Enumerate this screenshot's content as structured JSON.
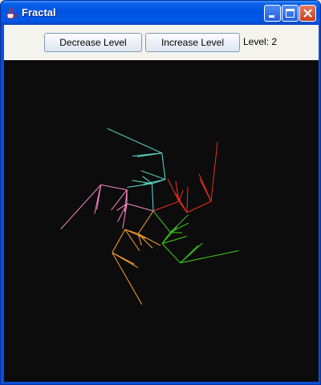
{
  "window": {
    "title": "Fractal",
    "icon": "java-cup-icon",
    "controls": [
      "minimize-icon",
      "maximize-icon",
      "close-icon"
    ]
  },
  "toolbar": {
    "decrease_label": "Decrease Level",
    "increase_label": "Increase Level",
    "level_text": "Level: 2"
  },
  "fractal": {
    "level": 2,
    "colors": [
      "#f03020",
      "#40d020",
      "#ffa030",
      "#ff88cc",
      "#60e0d0"
    ]
  }
}
